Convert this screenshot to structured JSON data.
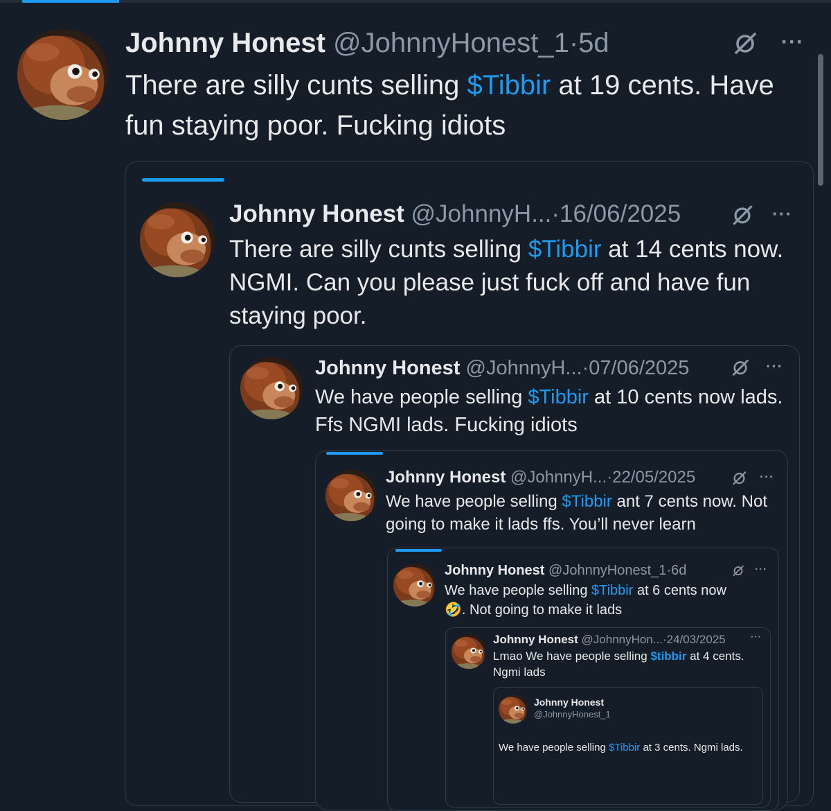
{
  "colors": {
    "background": "#151d28",
    "accent": "#1d9bf0",
    "muted": "#8b98a5",
    "text": "#e7e9ea",
    "border": "#2f3b47"
  },
  "icons": {
    "grok_icon": "slashed-circle-icon",
    "more_icon": "ellipsis-icon",
    "avatar": "monkey-puppet-avatar"
  },
  "main_tweet": {
    "name": "Johnny Honest",
    "handle": "@JohnnyHonest_1",
    "sep": "·",
    "date": "5d",
    "text_pre": "There are silly cunts selling ",
    "cashtag": "$Tibbir",
    "text_post": " at 19 cents. Have fun staying poor. Fucking idiots",
    "more": "···"
  },
  "quote1": {
    "name": "Johnny Honest",
    "handle": "@JohnnyH...",
    "sep": "·",
    "date": "16/06/2025",
    "text_pre": "There are silly cunts selling ",
    "cashtag": "$Tibbir",
    "text_post": " at 14 cents now. NGMI. Can you please just fuck off and have fun staying poor.",
    "more": "···"
  },
  "quote2": {
    "name": "Johnny Honest",
    "handle": "@JohnnyH...",
    "sep": "·",
    "date": "07/06/2025",
    "text_pre": "We have people selling ",
    "cashtag": "$Tibbir",
    "text_post": " at 10 cents now lads. Ffs  NGMI lads. Fucking idiots",
    "more": "···"
  },
  "quote3": {
    "name": "Johnny Honest",
    "handle": "@JohnnyH...",
    "sep": "·",
    "date": "22/05/2025",
    "text_pre": "We have people selling ",
    "cashtag": "$Tibbir",
    "text_post": " ant 7 cents now. Not going to make it lads ffs. You’ll never learn",
    "more": "···"
  },
  "quote4": {
    "name": "Johnny Honest",
    "handle": "@JohnnyHonest_1",
    "sep": "·",
    "date": "6d",
    "text_pre": "We have people selling ",
    "cashtag": "$Tibbir",
    "text_post": " at 6 cents now",
    "emoji": "🤣",
    "text_line2": ". Not going to make it lads",
    "more": "···"
  },
  "quote5": {
    "name": "Johnny Honest",
    "handle": "@JohnnyHon...",
    "sep": "·",
    "date": "24/03/2025",
    "text_pre": "Lmao We have people selling ",
    "cashtag": "$tibbir",
    "text_post": " at 4 cents. Ngmi lads",
    "more": "···"
  },
  "quote6": {
    "name": "Johnny Honest",
    "handle": "@JohnnyHonest_1",
    "text_pre": "We have people selling ",
    "cashtag": "$Tibbir",
    "text_post": " at 3 cents. Ngmi lads."
  }
}
